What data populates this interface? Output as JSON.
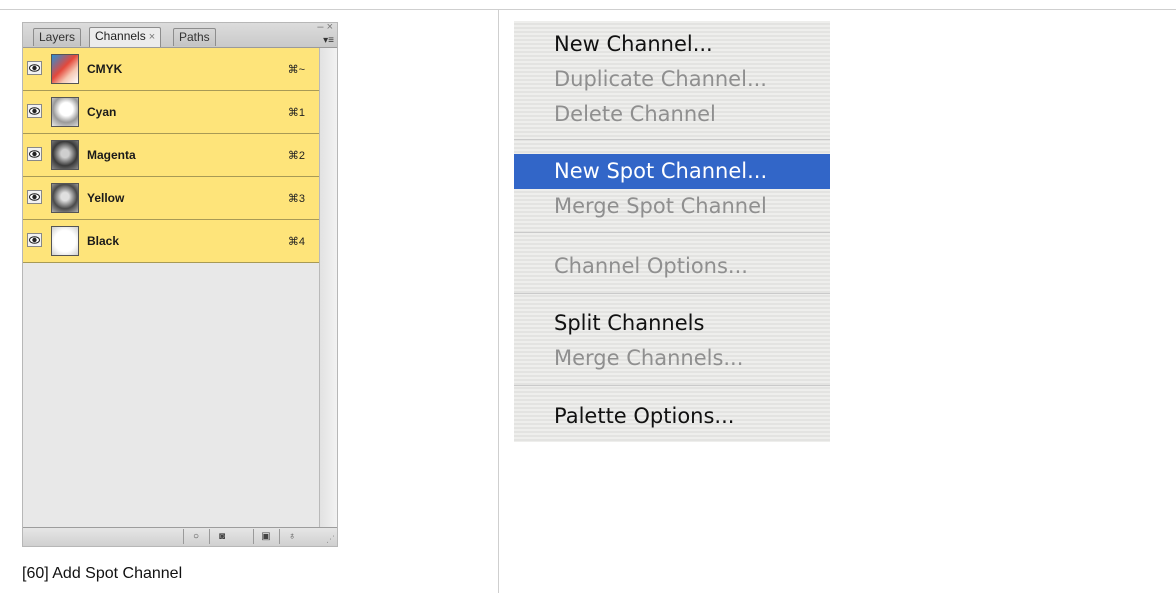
{
  "palette": {
    "tabs": [
      "Layers",
      "Channels",
      "Paths"
    ],
    "active_tab_close": "×",
    "window_controls": "– ×",
    "menu_button": "▾≡",
    "channels": [
      {
        "name": "CMYK",
        "shortcut": "⌘~"
      },
      {
        "name": "Cyan",
        "shortcut": "⌘1"
      },
      {
        "name": "Magenta",
        "shortcut": "⌘2"
      },
      {
        "name": "Yellow",
        "shortcut": "⌘3"
      },
      {
        "name": "Black",
        "shortcut": "⌘4"
      }
    ],
    "row_color": "#fee47a",
    "bottom_buttons": [
      "load-selection-icon",
      "save-selection-icon",
      "new-channel-icon",
      "trash-icon"
    ]
  },
  "caption": "[60] Add Spot Channel",
  "menu": {
    "highlight_color": "#3266c8",
    "items": [
      {
        "label": "New Channel...",
        "enabled": true
      },
      {
        "label": "Duplicate Channel...",
        "enabled": false
      },
      {
        "label": "Delete Channel",
        "enabled": false
      },
      {
        "label": "New Spot Channel...",
        "enabled": true,
        "highlighted": true
      },
      {
        "label": "Merge Spot Channel",
        "enabled": false
      },
      {
        "label": "Channel Options...",
        "enabled": false
      },
      {
        "label": "Split Channels",
        "enabled": true
      },
      {
        "label": "Merge Channels...",
        "enabled": false
      },
      {
        "label": "Palette Options...",
        "enabled": true
      }
    ]
  }
}
